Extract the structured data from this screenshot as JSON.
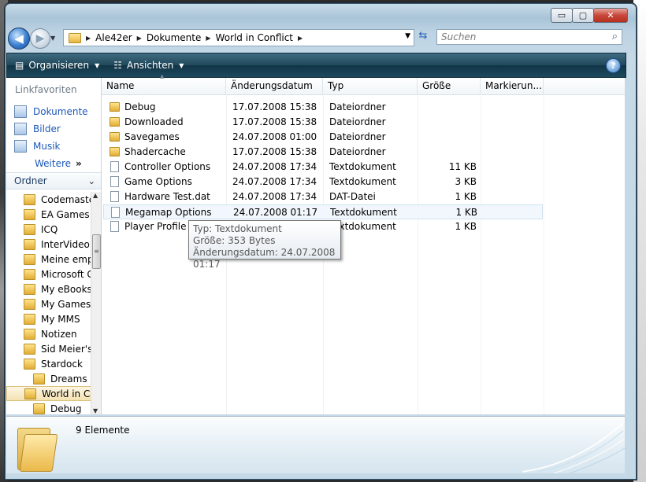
{
  "window": {
    "minimize": "▭",
    "maximize": "▢",
    "close": "✕"
  },
  "address": {
    "segments": [
      "Ale42er",
      "Dokumente",
      "World in Conflict"
    ]
  },
  "search": {
    "placeholder": "Suchen"
  },
  "toolbar": {
    "organize": "Organisieren",
    "views": "Ansichten",
    "help": "?"
  },
  "nav": {
    "favorites_header": "Linkfavoriten",
    "favorites": [
      "Dokumente",
      "Bilder",
      "Musik",
      "Weitere"
    ],
    "folders_header": "Ordner",
    "tree": [
      "Codemasters",
      "EA Games",
      "ICQ",
      "InterVideo",
      "Meine empf",
      "Microsoft G",
      "My eBooks",
      "My Games",
      "My MMS",
      "Notizen",
      "Sid Meier's",
      "Stardock",
      "Dreams",
      "World in C",
      "Debug"
    ]
  },
  "columns": {
    "name": "Name",
    "date": "Änderungsdatum",
    "type": "Typ",
    "size": "Größe",
    "tags": "Markierun..."
  },
  "files": [
    {
      "name": "Debug",
      "date": "17.07.2008 15:38",
      "type": "Dateiordner",
      "size": "",
      "kind": "folder"
    },
    {
      "name": "Downloaded",
      "date": "17.07.2008 15:38",
      "type": "Dateiordner",
      "size": "",
      "kind": "folder"
    },
    {
      "name": "Savegames",
      "date": "24.07.2008 01:00",
      "type": "Dateiordner",
      "size": "",
      "kind": "folder"
    },
    {
      "name": "Shadercache",
      "date": "17.07.2008 15:38",
      "type": "Dateiordner",
      "size": "",
      "kind": "folder"
    },
    {
      "name": "Controller Options",
      "date": "24.07.2008 17:34",
      "type": "Textdokument",
      "size": "11 KB",
      "kind": "doc"
    },
    {
      "name": "Game Options",
      "date": "24.07.2008 17:34",
      "type": "Textdokument",
      "size": "3 KB",
      "kind": "doc"
    },
    {
      "name": "Hardware Test.dat",
      "date": "24.07.2008 17:34",
      "type": "DAT-Datei",
      "size": "1 KB",
      "kind": "doc"
    },
    {
      "name": "Megamap Options",
      "date": "24.07.2008 01:17",
      "type": "Textdokument",
      "size": "1 KB",
      "kind": "doc"
    },
    {
      "name": "Player Profile",
      "date": "",
      "type": "Textdokument",
      "size": "1 KB",
      "kind": "doc"
    }
  ],
  "tooltip": {
    "line1": "Typ: Textdokument",
    "line2": "Größe: 353 Bytes",
    "line3": "Änderungsdatum: 24.07.2008 01:17"
  },
  "details": {
    "count": "9 Elemente"
  }
}
